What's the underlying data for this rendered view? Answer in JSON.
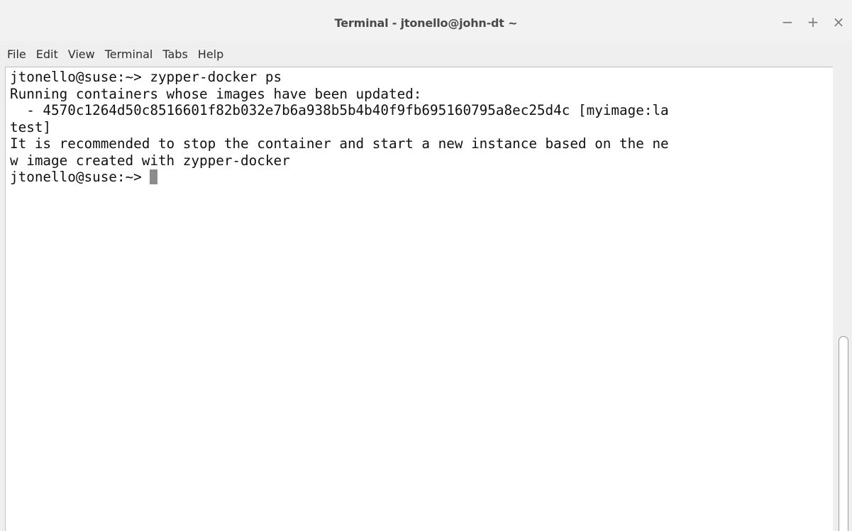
{
  "window": {
    "title": "Terminal - jtonello@john-dt ~",
    "controls": {
      "minimize": "−",
      "maximize": "+",
      "close": "×"
    }
  },
  "menubar": {
    "items": [
      "File",
      "Edit",
      "View",
      "Terminal",
      "Tabs",
      "Help"
    ]
  },
  "terminal": {
    "lines": [
      "jtonello@suse:~> zypper-docker ps",
      "Running containers whose images have been updated:",
      "  - 4570c1264d50c8516601f82b032e7b6a938b5b4b40f9fb695160795a8ec25d4c [myimage:la",
      "test]",
      "It is recommended to stop the container and start a new instance based on the ne",
      "w image created with zypper-docker",
      "jtonello@suse:~> "
    ]
  }
}
